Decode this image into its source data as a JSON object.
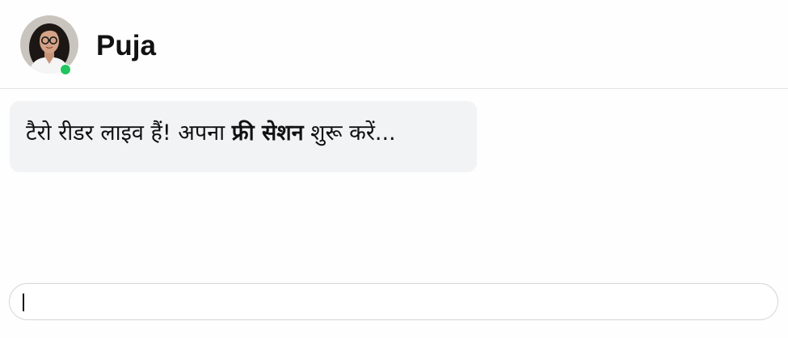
{
  "header": {
    "contact_name": "Puja",
    "online": true,
    "status_color": "#22c55e"
  },
  "messages": [
    {
      "from": "Puja",
      "text_before": "टैरो रीडर लाइव हैं! अपना ",
      "text_bold": "फ्री सेशन",
      "text_after": " शुरू करें..."
    }
  ],
  "composer": {
    "value": "",
    "placeholder": ""
  }
}
